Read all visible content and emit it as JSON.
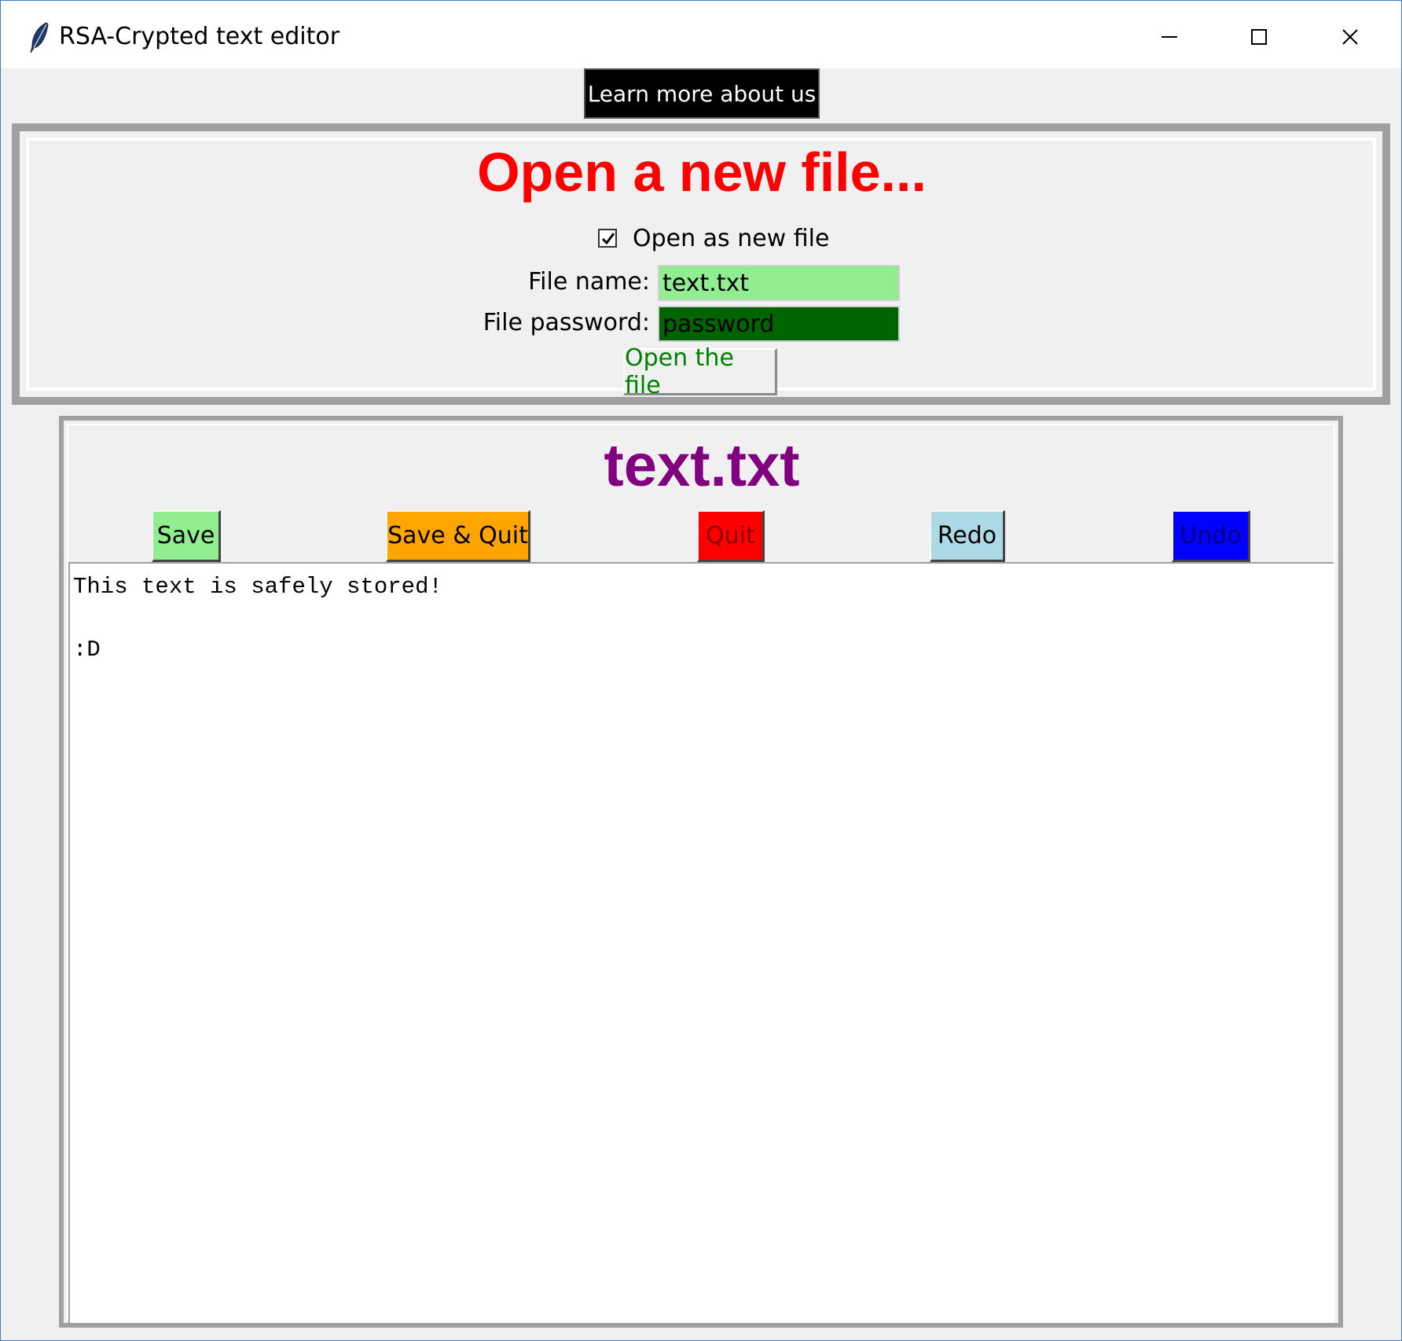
{
  "window": {
    "title": "RSA-Crypted text editor",
    "icons": [
      "feather-icon",
      "minimize-icon",
      "maximize-icon",
      "close-icon"
    ]
  },
  "header": {
    "learn_more_label": "Learn more about us"
  },
  "open_panel": {
    "title": "Open a new file...",
    "checkbox_label": "Open as new file",
    "checkbox_checked": true,
    "file_name_label": "File name:",
    "file_name_value": "text.txt",
    "file_password_label": "File password:",
    "file_password_value": "password",
    "open_button_label": "Open the file"
  },
  "editor": {
    "title": "text.txt",
    "buttons": {
      "save": "Save",
      "save_quit": "Save & Quit",
      "quit": "Quit",
      "redo": "Redo",
      "undo": "Undo"
    },
    "lines": [
      "This text is safely stored!",
      "",
      ":D"
    ]
  },
  "colors": {
    "open_title": "#ff0000",
    "editor_title": "#800080",
    "save_bg": "#90ee90",
    "save_quit_bg": "#ffa500",
    "quit_bg": "#ff0000",
    "redo_bg": "#add8e6",
    "undo_bg": "#0000ff",
    "file_name_bg": "#90ee90",
    "file_password_bg": "#006400",
    "open_button_text": "#008000"
  }
}
